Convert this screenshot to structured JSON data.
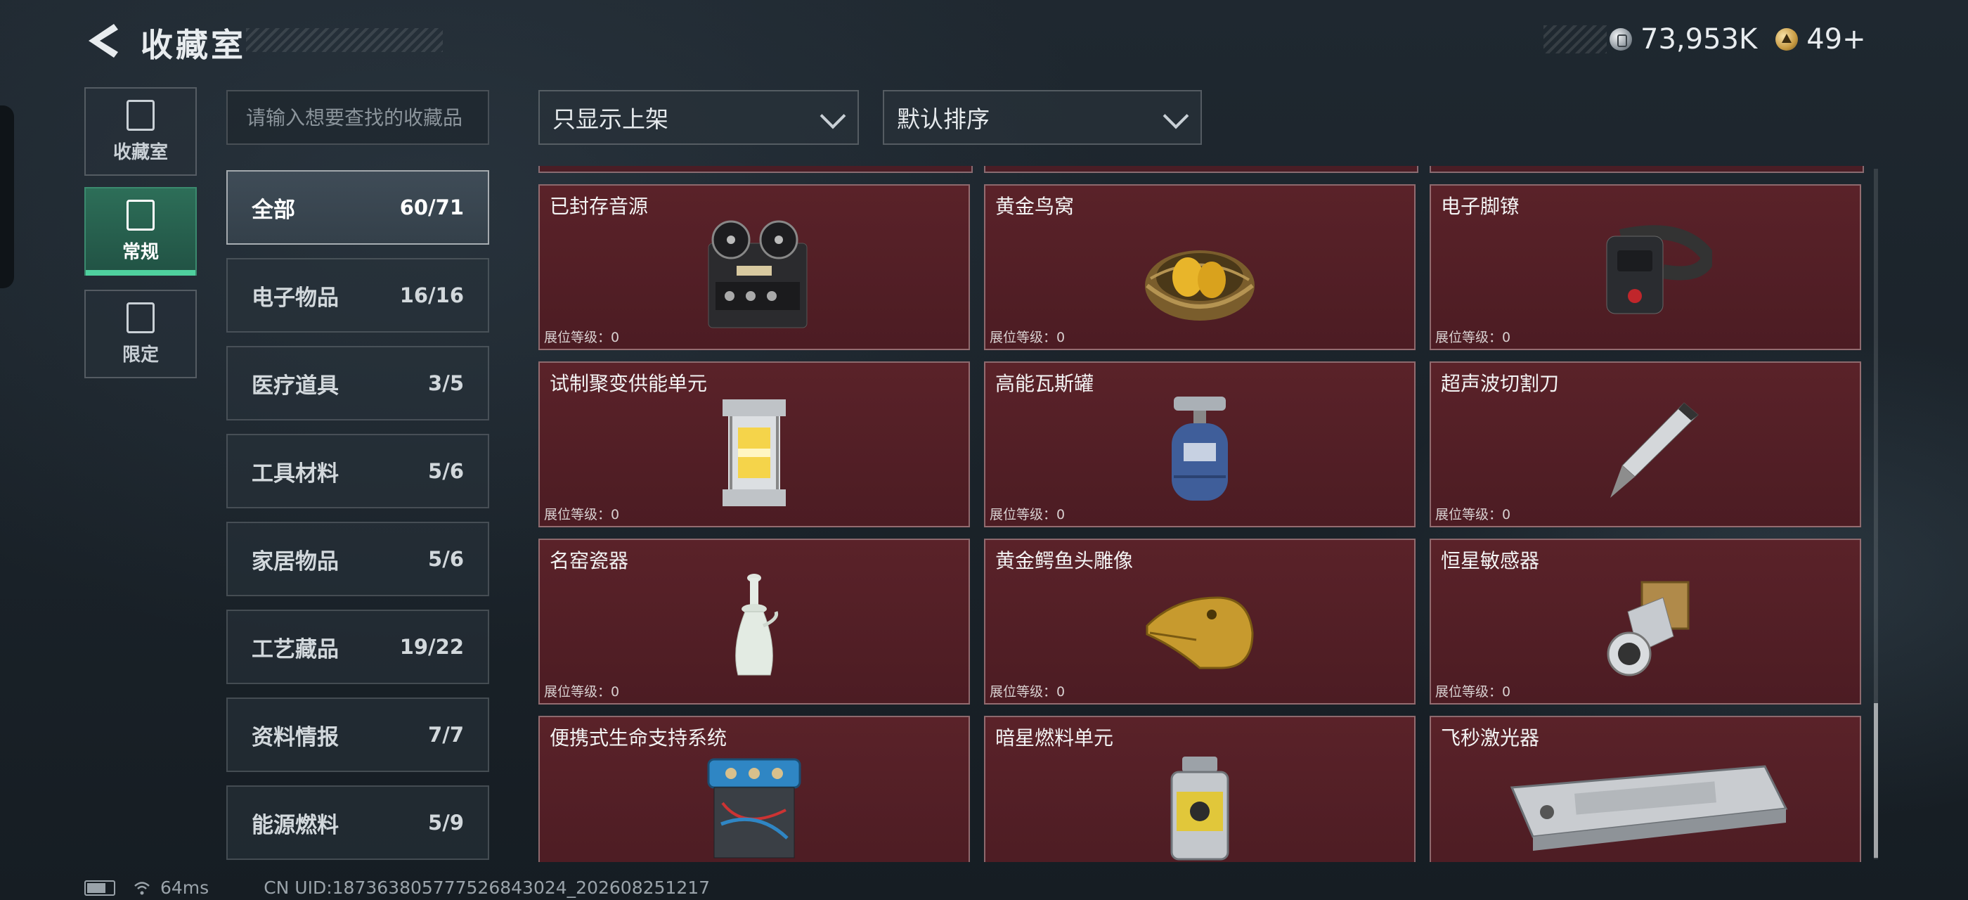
{
  "header": {
    "title": "收藏室",
    "currency": [
      {
        "icon": "silver-coin-icon",
        "value": "73,953K"
      },
      {
        "icon": "gold-coin-icon",
        "value": "49+"
      }
    ]
  },
  "side_tabs": [
    {
      "label": "收藏室",
      "icon": "collection-room-icon",
      "active": false
    },
    {
      "label": "常规",
      "icon": "regular-icon",
      "active": true
    },
    {
      "label": "限定",
      "icon": "limited-icon",
      "active": false
    }
  ],
  "search": {
    "placeholder": "请输入想要查找的收藏品"
  },
  "categories": [
    {
      "label": "全部",
      "count": "60/71",
      "active": true
    },
    {
      "label": "电子物品",
      "count": "16/16"
    },
    {
      "label": "医疗道具",
      "count": "3/5"
    },
    {
      "label": "工具材料",
      "count": "5/6"
    },
    {
      "label": "家居物品",
      "count": "5/6"
    },
    {
      "label": "工艺藏品",
      "count": "19/22"
    },
    {
      "label": "资料情报",
      "count": "7/7"
    },
    {
      "label": "能源燃料",
      "count": "5/9"
    }
  ],
  "filters": {
    "shelf_filter": "只显示上架",
    "sort": "默认排序"
  },
  "items": [
    {
      "name": "已封存音源",
      "level": "展位等级：0",
      "icon": "tape-recorder-icon"
    },
    {
      "name": "黄金鸟窝",
      "level": "展位等级：0",
      "icon": "golden-nest-icon"
    },
    {
      "name": "电子脚镣",
      "level": "展位等级：0",
      "icon": "ankle-monitor-icon"
    },
    {
      "name": "试制聚变供能单元",
      "level": "展位等级：0",
      "icon": "fusion-cell-icon"
    },
    {
      "name": "高能瓦斯罐",
      "level": "展位等级：0",
      "icon": "gas-canister-icon"
    },
    {
      "name": "超声波切割刀",
      "level": "展位等级：0",
      "icon": "ultrasonic-knife-icon"
    },
    {
      "name": "名窑瓷器",
      "level": "展位等级：0",
      "icon": "porcelain-vase-icon"
    },
    {
      "name": "黄金鳄鱼头雕像",
      "level": "展位等级：0",
      "icon": "golden-crocodile-icon"
    },
    {
      "name": "恒星敏感器",
      "level": "展位等级：0",
      "icon": "star-sensor-icon"
    },
    {
      "name": "便携式生命支持系统",
      "level": "",
      "icon": "life-support-icon"
    },
    {
      "name": "暗星燃料单元",
      "level": "",
      "icon": "fuel-cell-icon"
    },
    {
      "name": "飞秒激光器",
      "level": "",
      "icon": "femtosecond-laser-icon"
    }
  ],
  "status": {
    "ping": "64ms",
    "uid": "CN UID:187363805777526843024_202608251217"
  },
  "colors": {
    "card_bg": "#5a2229",
    "active_tab": "#2d6e58",
    "active_indicator": "#4fd09e"
  }
}
